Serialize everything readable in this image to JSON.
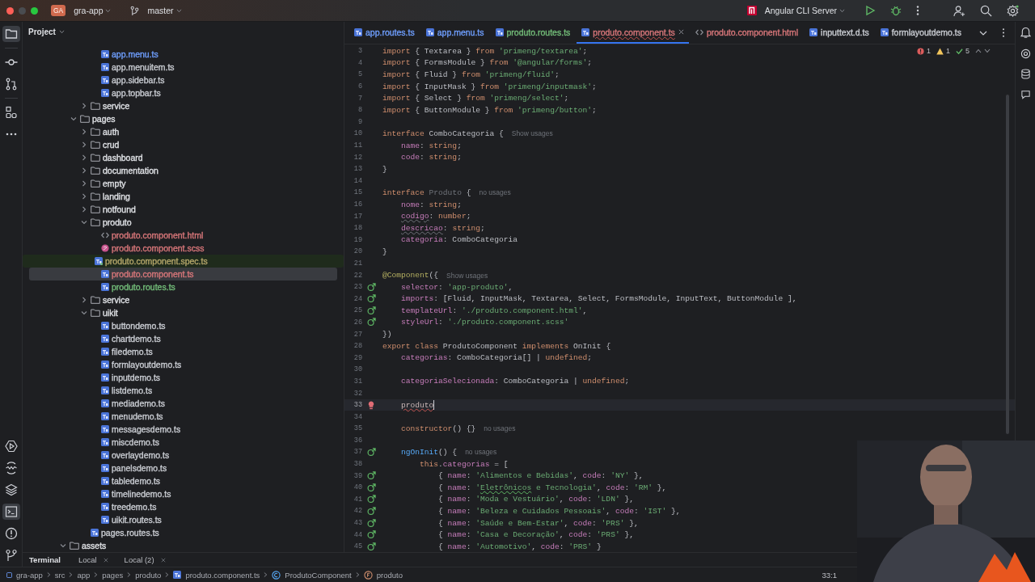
{
  "title_bar": {
    "project_badge": "GA",
    "project": "gra-app",
    "branch": "master",
    "run_config": "Angular CLI Server"
  },
  "left_toolbar": [
    {
      "kind": "project",
      "selected": true
    },
    {
      "kind": "commit",
      "selected": false
    },
    {
      "kind": "pull-request",
      "selected": false
    },
    {
      "kind": "structure",
      "selected": false
    },
    {
      "kind": "more",
      "selected": false
    }
  ],
  "left_toolbar_bottom": [
    {
      "kind": "run",
      "selected": false
    },
    {
      "kind": "services",
      "selected": false
    },
    {
      "kind": "layers",
      "selected": false
    },
    {
      "kind": "terminal",
      "selected": true
    },
    {
      "kind": "problems",
      "selected": false
    },
    {
      "kind": "git",
      "selected": false
    }
  ],
  "project_panel": {
    "title": "Project",
    "tree": [
      {
        "children": [
          {
            "children": [
              {
                "children": [
                  {
                    "label": "app.menu.ts",
                    "kind": "ts",
                    "color": "#6f9fff",
                    "selected": false,
                    "highlighted": false
                  },
                  {
                    "label": "app.menuitem.ts",
                    "kind": "ts",
                    "color": "#c9ccd2",
                    "selected": false,
                    "highlighted": false
                  },
                  {
                    "label": "app.sidebar.ts",
                    "kind": "ts",
                    "color": "#c9ccd2",
                    "selected": false,
                    "highlighted": false
                  },
                  {
                    "label": "app.topbar.ts",
                    "kind": "ts",
                    "color": "#c9ccd2",
                    "selected": false,
                    "highlighted": false
                  }
                ]
              },
              {
                "label": "service",
                "kind": "folder",
                "expanded": false,
                "selected": false,
                "highlighted": false
              }
            ]
          },
          {
            "label": "pages",
            "kind": "folder",
            "expanded": true,
            "selected": false,
            "highlighted": false,
            "children": [
              {
                "label": "auth",
                "kind": "folder",
                "expanded": false,
                "selected": false,
                "highlighted": false
              },
              {
                "label": "crud",
                "kind": "folder",
                "expanded": false,
                "selected": false,
                "highlighted": false
              },
              {
                "label": "dashboard",
                "kind": "folder",
                "expanded": false,
                "selected": false,
                "highlighted": false
              },
              {
                "label": "documentation",
                "kind": "folder",
                "expanded": false,
                "selected": false,
                "highlighted": false
              },
              {
                "label": "empty",
                "kind": "folder",
                "expanded": false,
                "selected": false,
                "highlighted": false
              },
              {
                "label": "landing",
                "kind": "folder",
                "expanded": false,
                "selected": false,
                "highlighted": false
              },
              {
                "label": "notfound",
                "kind": "folder",
                "expanded": false,
                "selected": false,
                "highlighted": false
              },
              {
                "label": "produto",
                "kind": "folder",
                "expanded": true,
                "selected": false,
                "highlighted": false,
                "children": [
                  {
                    "label": "produto.component.html",
                    "kind": "html",
                    "color": "#d9777a",
                    "selected": false,
                    "highlighted": false
                  },
                  {
                    "label": "produto.component.scss",
                    "kind": "scss",
                    "color": "#d9777a",
                    "selected": false,
                    "highlighted": false
                  },
                  {
                    "label": "produto.component.spec.ts",
                    "kind": "spec",
                    "color": "#b5a76a",
                    "selected": false,
                    "highlighted": true
                  },
                  {
                    "label": "produto.component.ts",
                    "kind": "ts",
                    "color": "#d9777a",
                    "selected": true,
                    "highlighted": false
                  },
                  {
                    "label": "produto.routes.ts",
                    "kind": "ts",
                    "color": "#73bd79",
                    "selected": false,
                    "highlighted": false
                  }
                ]
              },
              {
                "label": "service",
                "kind": "folder",
                "expanded": false,
                "selected": false,
                "highlighted": false
              },
              {
                "label": "uikit",
                "kind": "folder",
                "expanded": true,
                "selected": false,
                "highlighted": false,
                "children": [
                  {
                    "label": "buttondemo.ts",
                    "kind": "ts",
                    "color": "#c9ccd2",
                    "selected": false,
                    "highlighted": false
                  },
                  {
                    "label": "chartdemo.ts",
                    "kind": "ts",
                    "color": "#c9ccd2",
                    "selected": false,
                    "highlighted": false
                  },
                  {
                    "label": "filedemo.ts",
                    "kind": "ts",
                    "color": "#c9ccd2",
                    "selected": false,
                    "highlighted": false
                  },
                  {
                    "label": "formlayoutdemo.ts",
                    "kind": "ts",
                    "color": "#c9ccd2",
                    "selected": false,
                    "highlighted": false
                  },
                  {
                    "label": "inputdemo.ts",
                    "kind": "ts",
                    "color": "#c9ccd2",
                    "selected": false,
                    "highlighted": false
                  },
                  {
                    "label": "listdemo.ts",
                    "kind": "ts",
                    "color": "#c9ccd2",
                    "selected": false,
                    "highlighted": false
                  },
                  {
                    "label": "mediademo.ts",
                    "kind": "ts",
                    "color": "#c9ccd2",
                    "selected": false,
                    "highlighted": false
                  },
                  {
                    "label": "menudemo.ts",
                    "kind": "ts",
                    "color": "#c9ccd2",
                    "selected": false,
                    "highlighted": false
                  },
                  {
                    "label": "messagesdemo.ts",
                    "kind": "ts",
                    "color": "#c9ccd2",
                    "selected": false,
                    "highlighted": false
                  },
                  {
                    "label": "miscdemo.ts",
                    "kind": "ts",
                    "color": "#c9ccd2",
                    "selected": false,
                    "highlighted": false
                  },
                  {
                    "label": "overlaydemo.ts",
                    "kind": "ts",
                    "color": "#c9ccd2",
                    "selected": false,
                    "highlighted": false
                  },
                  {
                    "label": "panelsdemo.ts",
                    "kind": "ts",
                    "color": "#c9ccd2",
                    "selected": false,
                    "highlighted": false
                  },
                  {
                    "label": "tabledemo.ts",
                    "kind": "ts",
                    "color": "#c9ccd2",
                    "selected": false,
                    "highlighted": false
                  },
                  {
                    "label": "timelinedemo.ts",
                    "kind": "ts",
                    "color": "#c9ccd2",
                    "selected": false,
                    "highlighted": false
                  },
                  {
                    "label": "treedemo.ts",
                    "kind": "ts",
                    "color": "#c9ccd2",
                    "selected": false,
                    "highlighted": false
                  },
                  {
                    "label": "uikit.routes.ts",
                    "kind": "ts",
                    "color": "#c9ccd2",
                    "selected": false,
                    "highlighted": false
                  }
                ]
              },
              {
                "label": "pages.routes.ts",
                "kind": "ts",
                "color": "#c9ccd2",
                "selected": false,
                "highlighted": false
              }
            ]
          }
        ]
      },
      {
        "label": "assets",
        "kind": "folder",
        "expanded": true,
        "selected": false,
        "highlighted": false
      }
    ]
  },
  "editor_tabs": [
    {
      "label": "app.routes.ts",
      "kind": "ts",
      "color": "#6f9fff",
      "selected": false
    },
    {
      "label": "app.menu.ts",
      "kind": "ts",
      "color": "#6f9fff",
      "selected": false
    },
    {
      "label": "produto.routes.ts",
      "kind": "ts",
      "color": "#73bd79",
      "selected": false
    },
    {
      "label": "produto.component.ts",
      "kind": "ts",
      "color": "#d9777a",
      "selected": true
    },
    {
      "label": "produto.component.html",
      "kind": "html",
      "color": "#d9777a",
      "selected": false
    },
    {
      "label": "inputtext.d.ts",
      "kind": "ts",
      "color": "#c9ccd2",
      "selected": false
    },
    {
      "label": "formlayoutdemo.ts",
      "kind": "ts",
      "color": "#c9ccd2",
      "selected": false
    }
  ],
  "inspections": {
    "errors": "1",
    "warnings": "1",
    "ok": "5"
  },
  "code_lines": [
    {
      "number": "3",
      "kind": "plain",
      "current": false,
      "segments": [
        {
          "kind": "kw",
          "text": "import"
        },
        {
          "kind": "plain",
          "text": " { Textarea } "
        },
        {
          "kind": "kw",
          "text": "from"
        },
        {
          "kind": "str",
          "text": " 'primeng/textarea'"
        },
        {
          "kind": "plain",
          "text": ";"
        }
      ]
    },
    {
      "number": "4",
      "kind": "plain",
      "current": false,
      "segments": [
        {
          "kind": "kw",
          "text": "import"
        },
        {
          "kind": "plain",
          "text": " { FormsModule } "
        },
        {
          "kind": "kw",
          "text": "from"
        },
        {
          "kind": "str",
          "text": " '@angular/forms'"
        },
        {
          "kind": "plain",
          "text": ";"
        }
      ]
    },
    {
      "number": "5",
      "kind": "plain",
      "current": false,
      "segments": [
        {
          "kind": "kw",
          "text": "import"
        },
        {
          "kind": "plain",
          "text": " { Fluid } "
        },
        {
          "kind": "kw",
          "text": "from"
        },
        {
          "kind": "str",
          "text": " 'primeng/fluid'"
        },
        {
          "kind": "plain",
          "text": ";"
        }
      ]
    },
    {
      "number": "6",
      "kind": "plain",
      "current": false,
      "segments": [
        {
          "kind": "kw",
          "text": "import"
        },
        {
          "kind": "plain",
          "text": " { InputMask } "
        },
        {
          "kind": "kw",
          "text": "from"
        },
        {
          "kind": "str",
          "text": " 'primeng/inputmask'"
        },
        {
          "kind": "plain",
          "text": ";"
        }
      ]
    },
    {
      "number": "7",
      "kind": "plain",
      "current": false,
      "segments": [
        {
          "kind": "kw",
          "text": "import"
        },
        {
          "kind": "plain",
          "text": " { Select } "
        },
        {
          "kind": "kw",
          "text": "from"
        },
        {
          "kind": "str",
          "text": " 'primeng/select'"
        },
        {
          "kind": "plain",
          "text": ";"
        }
      ]
    },
    {
      "number": "8",
      "kind": "plain",
      "current": false,
      "segments": [
        {
          "kind": "kw",
          "text": "import"
        },
        {
          "kind": "plain",
          "text": " { ButtonModule } "
        },
        {
          "kind": "kw",
          "text": "from"
        },
        {
          "kind": "str",
          "text": " 'primeng/button'"
        },
        {
          "kind": "plain",
          "text": ";"
        }
      ]
    },
    {
      "number": "9",
      "kind": "plain",
      "current": false
    },
    {
      "number": "10",
      "kind": "plain",
      "current": false,
      "hint": "Show usages",
      "segments": [
        {
          "kind": "kw",
          "text": "interface"
        },
        {
          "kind": "plain",
          "text": " ComboCategoria {"
        }
      ]
    },
    {
      "number": "11",
      "kind": "plain",
      "current": false,
      "segments": [
        {
          "kind": "prop",
          "text": "    name"
        },
        {
          "kind": "plain",
          "text": ": "
        },
        {
          "kind": "kw",
          "text": "string"
        },
        {
          "kind": "plain",
          "text": ";"
        }
      ]
    },
    {
      "number": "12",
      "kind": "plain",
      "current": false,
      "segments": [
        {
          "kind": "prop",
          "text": "    code"
        },
        {
          "kind": "plain",
          "text": ": "
        },
        {
          "kind": "kw",
          "text": "string"
        },
        {
          "kind": "plain",
          "text": ";"
        }
      ]
    },
    {
      "number": "13",
      "kind": "plain",
      "current": false,
      "segments": [
        {
          "kind": "plain",
          "text": "}"
        }
      ]
    },
    {
      "number": "14",
      "kind": "plain",
      "current": false
    },
    {
      "number": "15",
      "kind": "plain",
      "current": false,
      "hint": "no usages",
      "segments": [
        {
          "kind": "kw",
          "text": "interface"
        },
        {
          "kind": "dim",
          "text": " Produto"
        },
        {
          "kind": "plain",
          "text": " {"
        }
      ]
    },
    {
      "number": "16",
      "kind": "plain",
      "current": false,
      "segments": [
        {
          "kind": "prop",
          "text": "    nome"
        },
        {
          "kind": "plain",
          "text": ": "
        },
        {
          "kind": "kw",
          "text": "string"
        },
        {
          "kind": "plain",
          "text": ";"
        }
      ]
    },
    {
      "number": "17",
      "kind": "plain",
      "current": false,
      "segments": [
        {
          "kind": "warn",
          "text": "    codigo"
        },
        {
          "kind": "plain",
          "text": ": "
        },
        {
          "kind": "kw",
          "text": "number"
        },
        {
          "kind": "plain",
          "text": ";"
        }
      ]
    },
    {
      "number": "18",
      "kind": "plain",
      "current": false,
      "segments": [
        {
          "kind": "warn",
          "text": "    descricao"
        },
        {
          "kind": "plain",
          "text": ": "
        },
        {
          "kind": "kw",
          "text": "string"
        },
        {
          "kind": "plain",
          "text": ";"
        }
      ]
    },
    {
      "number": "19",
      "kind": "plain",
      "current": false,
      "segments": [
        {
          "kind": "prop",
          "text": "    categoria"
        },
        {
          "kind": "plain",
          "text": ": ComboCategoria"
        }
      ]
    },
    {
      "number": "20",
      "kind": "plain",
      "current": false,
      "segments": [
        {
          "kind": "plain",
          "text": "}"
        }
      ]
    },
    {
      "number": "21",
      "kind": "plain",
      "current": false
    },
    {
      "number": "22",
      "kind": "plain",
      "current": false,
      "hint": "Show usages",
      "segments": [
        {
          "kind": "dec",
          "text": "@Component"
        },
        {
          "kind": "plain",
          "text": "({"
        }
      ]
    },
    {
      "number": "23",
      "kind": "override",
      "current": false,
      "segments": [
        {
          "kind": "prop",
          "text": "    selector"
        },
        {
          "kind": "plain",
          "text": ": "
        },
        {
          "kind": "str",
          "text": "'app-produto'"
        },
        {
          "kind": "plain",
          "text": ","
        }
      ]
    },
    {
      "number": "24",
      "kind": "override",
      "current": false,
      "segments": [
        {
          "kind": "prop",
          "text": "    imports"
        },
        {
          "kind": "plain",
          "text": ": [Fluid, InputMask, Textarea, Select, FormsModule, InputText, ButtonModule ],"
        }
      ]
    },
    {
      "number": "25",
      "kind": "override",
      "current": false,
      "segments": [
        {
          "kind": "prop",
          "text": "    templateUrl"
        },
        {
          "kind": "plain",
          "text": ": "
        },
        {
          "kind": "str",
          "text": "'./produto.component.html'"
        },
        {
          "kind": "plain",
          "text": ","
        }
      ]
    },
    {
      "number": "26",
      "kind": "override",
      "current": false,
      "segments": [
        {
          "kind": "prop",
          "text": "    styleUrl"
        },
        {
          "kind": "plain",
          "text": ": "
        },
        {
          "kind": "str",
          "text": "'./produto.component.scss'"
        }
      ]
    },
    {
      "number": "27",
      "kind": "plain",
      "current": false,
      "segments": [
        {
          "kind": "plain",
          "text": "})"
        }
      ]
    },
    {
      "number": "28",
      "kind": "plain",
      "current": false,
      "segments": [
        {
          "kind": "kw",
          "text": "export class"
        },
        {
          "kind": "plain",
          "text": " ProdutoComponent "
        },
        {
          "kind": "kw",
          "text": "implements"
        },
        {
          "kind": "plain",
          "text": " OnInit {"
        }
      ]
    },
    {
      "number": "29",
      "kind": "plain",
      "current": false,
      "segments": [
        {
          "kind": "prop",
          "text": "    categorias"
        },
        {
          "kind": "plain",
          "text": ": ComboCategoria[] | "
        },
        {
          "kind": "kw",
          "text": "undefined"
        },
        {
          "kind": "plain",
          "text": ";"
        }
      ]
    },
    {
      "number": "30",
      "kind": "plain",
      "current": false
    },
    {
      "number": "31",
      "kind": "plain",
      "current": false,
      "segments": [
        {
          "kind": "prop",
          "text": "    categoriaSelecionada"
        },
        {
          "kind": "plain",
          "text": ": ComboCategoria | "
        },
        {
          "kind": "kw",
          "text": "undefined"
        },
        {
          "kind": "plain",
          "text": ";"
        }
      ]
    },
    {
      "number": "32",
      "kind": "plain",
      "current": false
    },
    {
      "number": "33",
      "kind": "bulb",
      "current": true,
      "segments": [
        {
          "kind": "err",
          "text": "    produto"
        }
      ]
    },
    {
      "number": "34",
      "kind": "plain",
      "current": false
    },
    {
      "number": "35",
      "kind": "plain",
      "current": false,
      "hint": "no usages",
      "segments": [
        {
          "kind": "kw",
          "text": "    constructor"
        },
        {
          "kind": "plain",
          "text": "() {}"
        }
      ]
    },
    {
      "number": "36",
      "kind": "plain",
      "current": false
    },
    {
      "number": "37",
      "kind": "override",
      "current": false,
      "hint": "no usages",
      "segments": [
        {
          "kind": "fn",
          "text": "    ngOnInit"
        },
        {
          "kind": "plain",
          "text": "() {"
        }
      ]
    },
    {
      "number": "38",
      "kind": "plain",
      "current": false,
      "segments": [
        {
          "kind": "kw",
          "text": "        this"
        },
        {
          "kind": "plain",
          "text": "."
        },
        {
          "kind": "prop",
          "text": "categorias"
        },
        {
          "kind": "plain",
          "text": " = ["
        }
      ]
    },
    {
      "number": "39",
      "kind": "override",
      "current": false,
      "segments": [
        {
          "kind": "plain",
          "text": "            { "
        },
        {
          "kind": "prop",
          "text": "name"
        },
        {
          "kind": "plain",
          "text": ": "
        },
        {
          "kind": "str",
          "text": "'Alimentos e Bebidas'"
        },
        {
          "kind": "plain",
          "text": ", "
        },
        {
          "kind": "prop",
          "text": "code"
        },
        {
          "kind": "plain",
          "text": ": "
        },
        {
          "kind": "str",
          "text": "'NY'"
        },
        {
          "kind": "plain",
          "text": " },"
        }
      ]
    },
    {
      "number": "40",
      "kind": "override",
      "current": false,
      "segments": [
        {
          "kind": "plain",
          "text": "            { "
        },
        {
          "kind": "prop",
          "text": "name"
        },
        {
          "kind": "plain",
          "text": ": "
        },
        {
          "kind": "str",
          "text": "'"
        },
        {
          "kind": "typo",
          "text": "Eletrônicos"
        },
        {
          "kind": "str",
          "text": " e Tecnologia'"
        },
        {
          "kind": "plain",
          "text": ", "
        },
        {
          "kind": "prop",
          "text": "code"
        },
        {
          "kind": "plain",
          "text": ": "
        },
        {
          "kind": "str",
          "text": "'RM'"
        },
        {
          "kind": "plain",
          "text": " },"
        }
      ]
    },
    {
      "number": "41",
      "kind": "override",
      "current": false,
      "segments": [
        {
          "kind": "plain",
          "text": "            { "
        },
        {
          "kind": "prop",
          "text": "name"
        },
        {
          "kind": "plain",
          "text": ": "
        },
        {
          "kind": "str",
          "text": "'Moda e Vestuário'"
        },
        {
          "kind": "plain",
          "text": ", "
        },
        {
          "kind": "prop",
          "text": "code"
        },
        {
          "kind": "plain",
          "text": ": "
        },
        {
          "kind": "str",
          "text": "'LDN'"
        },
        {
          "kind": "plain",
          "text": " },"
        }
      ]
    },
    {
      "number": "42",
      "kind": "override",
      "current": false,
      "segments": [
        {
          "kind": "plain",
          "text": "            { "
        },
        {
          "kind": "prop",
          "text": "name"
        },
        {
          "kind": "plain",
          "text": ": "
        },
        {
          "kind": "str",
          "text": "'Beleza e Cuidados Pessoais'"
        },
        {
          "kind": "plain",
          "text": ", "
        },
        {
          "kind": "prop",
          "text": "code"
        },
        {
          "kind": "plain",
          "text": ": "
        },
        {
          "kind": "str",
          "text": "'IST'"
        },
        {
          "kind": "plain",
          "text": " },"
        }
      ]
    },
    {
      "number": "43",
      "kind": "override",
      "current": false,
      "segments": [
        {
          "kind": "plain",
          "text": "            { "
        },
        {
          "kind": "prop",
          "text": "name"
        },
        {
          "kind": "plain",
          "text": ": "
        },
        {
          "kind": "str",
          "text": "'Saúde e Bem-Estar'"
        },
        {
          "kind": "plain",
          "text": ", "
        },
        {
          "kind": "prop",
          "text": "code"
        },
        {
          "kind": "plain",
          "text": ": "
        },
        {
          "kind": "str",
          "text": "'PRS'"
        },
        {
          "kind": "plain",
          "text": " },"
        }
      ]
    },
    {
      "number": "44",
      "kind": "override",
      "current": false,
      "segments": [
        {
          "kind": "plain",
          "text": "            { "
        },
        {
          "kind": "prop",
          "text": "name"
        },
        {
          "kind": "plain",
          "text": ": "
        },
        {
          "kind": "str",
          "text": "'Casa e Decoração'"
        },
        {
          "kind": "plain",
          "text": ", "
        },
        {
          "kind": "prop",
          "text": "code"
        },
        {
          "kind": "plain",
          "text": ": "
        },
        {
          "kind": "str",
          "text": "'PRS'"
        },
        {
          "kind": "plain",
          "text": " },"
        }
      ]
    },
    {
      "number": "45",
      "kind": "override",
      "current": false,
      "segments": [
        {
          "kind": "plain",
          "text": "            { "
        },
        {
          "kind": "prop",
          "text": "name"
        },
        {
          "kind": "plain",
          "text": ": "
        },
        {
          "kind": "str",
          "text": "'Automotivo'"
        },
        {
          "kind": "plain",
          "text": ", "
        },
        {
          "kind": "prop",
          "text": "code"
        },
        {
          "kind": "plain",
          "text": ": "
        },
        {
          "kind": "str",
          "text": "'PRS'"
        },
        {
          "kind": "plain",
          "text": " }"
        }
      ]
    }
  ],
  "tool_tabs": [
    {
      "label": "Terminal",
      "closable": false,
      "selected": true
    },
    {
      "label": "Local",
      "closable": true,
      "selected": false
    },
    {
      "label": "Local (2)",
      "closable": true,
      "selected": false
    }
  ],
  "breadcrumbs": [
    {
      "label": "gra-app",
      "kind": "module"
    },
    {
      "label": "src",
      "kind": "plain"
    },
    {
      "label": "app",
      "kind": "plain"
    },
    {
      "label": "pages",
      "kind": "plain"
    },
    {
      "label": "produto",
      "kind": "plain"
    },
    {
      "label": "produto.component.ts",
      "kind": "ts"
    },
    {
      "label": "ProdutoComponent",
      "kind": "class"
    },
    {
      "label": "produto",
      "kind": "field"
    }
  ],
  "caret_position": "33:1"
}
